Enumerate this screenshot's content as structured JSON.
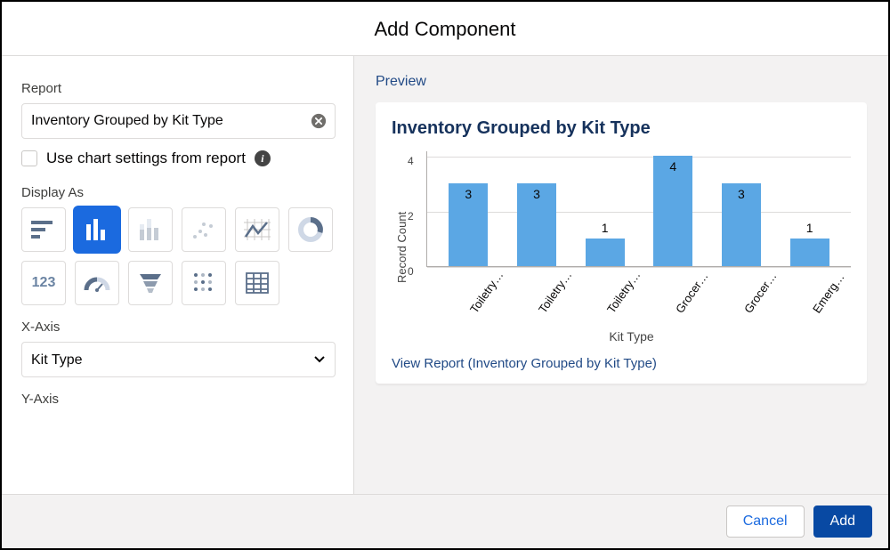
{
  "modal": {
    "title": "Add Component"
  },
  "left": {
    "report_label": "Report",
    "report_value": "Inventory Grouped by Kit Type",
    "checkbox_label": "Use chart settings from report",
    "display_as_label": "Display As",
    "x_axis_label": "X-Axis",
    "x_axis_value": "Kit Type",
    "y_axis_label": "Y-Axis"
  },
  "icons": [
    {
      "name": "horizontal-bar-chart",
      "selected": false
    },
    {
      "name": "vertical-bar-chart",
      "selected": true
    },
    {
      "name": "stacked-bar-chart",
      "selected": false
    },
    {
      "name": "scatter-chart",
      "selected": false
    },
    {
      "name": "line-chart",
      "selected": false
    },
    {
      "name": "donut-chart",
      "selected": false
    },
    {
      "name": "metric-chart",
      "selected": false
    },
    {
      "name": "gauge-chart",
      "selected": false
    },
    {
      "name": "funnel-chart",
      "selected": false
    },
    {
      "name": "matrix-chart",
      "selected": false
    },
    {
      "name": "table-chart",
      "selected": false
    }
  ],
  "preview": {
    "label": "Preview",
    "chart_title": "Inventory Grouped by Kit Type",
    "view_report": "View Report (Inventory Grouped by Kit Type)"
  },
  "chart_data": {
    "type": "bar",
    "categories": [
      "Toiletry…",
      "Toiletry…",
      "Toiletry…",
      "Grocer…",
      "Grocer…",
      "Emerg…"
    ],
    "values": [
      3,
      3,
      1,
      4,
      3,
      1
    ],
    "title": "Inventory Grouped by Kit Type",
    "xlabel": "Kit Type",
    "ylabel": "Record Count",
    "yticks": [
      0,
      2,
      4
    ],
    "ylim": [
      0,
      4.2
    ]
  },
  "footer": {
    "cancel": "Cancel",
    "add": "Add"
  }
}
